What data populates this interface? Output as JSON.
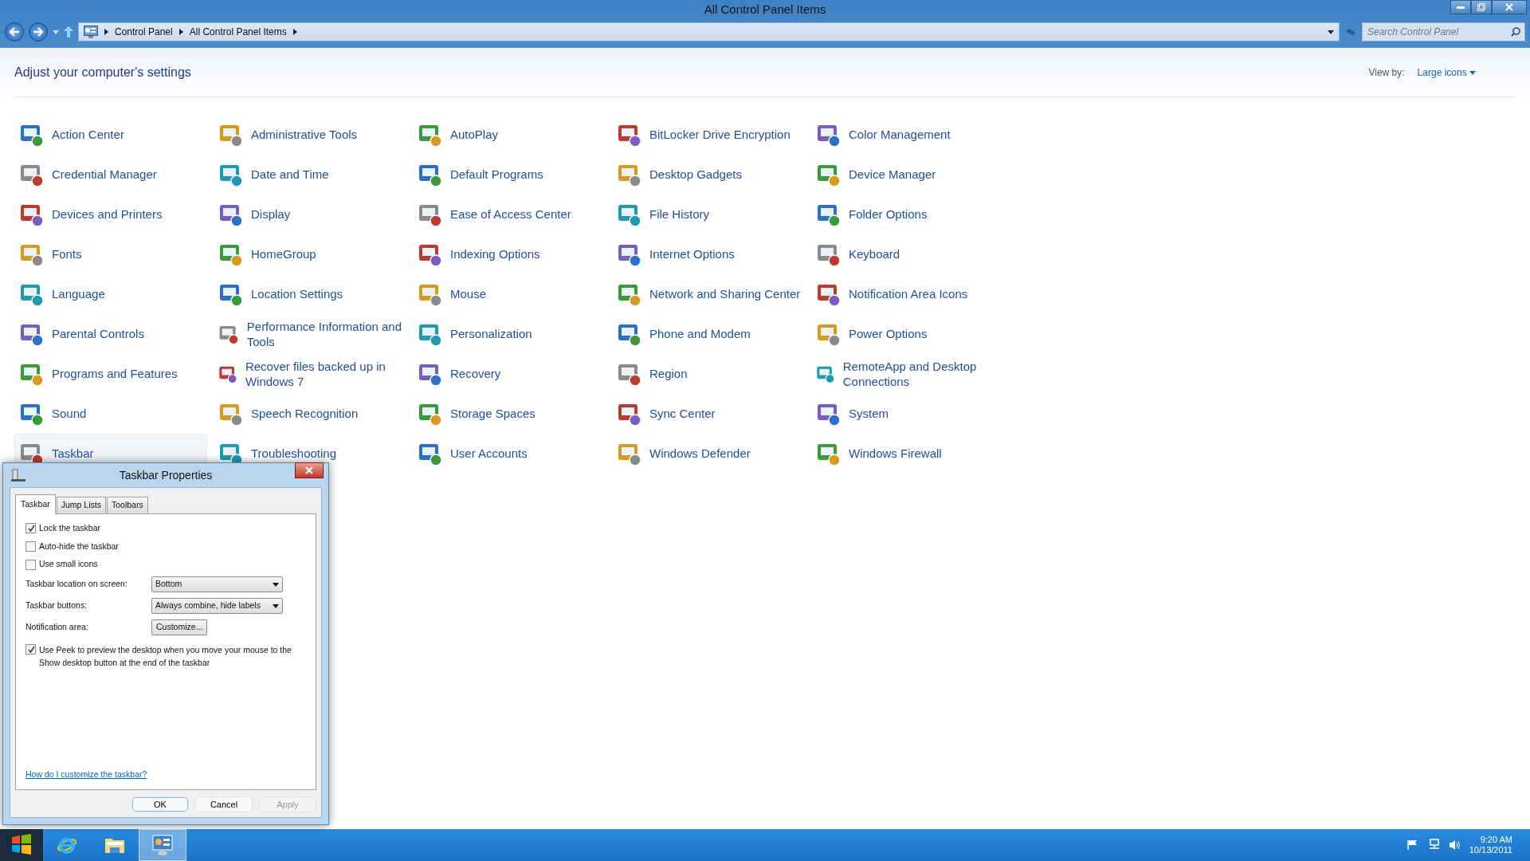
{
  "window": {
    "title": "All Control Panel Items"
  },
  "address_bar": {
    "crumbs": [
      "Control Panel",
      "All Control Panel Items"
    ]
  },
  "search": {
    "placeholder": "Search Control Panel"
  },
  "heading": "Adjust your computer's settings",
  "view_by": {
    "label": "View by:",
    "value": "Large icons"
  },
  "items": [
    {
      "label": "Action Center",
      "selected": false
    },
    {
      "label": "Administrative Tools",
      "selected": false
    },
    {
      "label": "AutoPlay",
      "selected": false
    },
    {
      "label": "BitLocker Drive Encryption",
      "selected": false
    },
    {
      "label": "Color Management",
      "selected": false
    },
    {
      "label": "Credential Manager",
      "selected": false
    },
    {
      "label": "Date and Time",
      "selected": false
    },
    {
      "label": "Default Programs",
      "selected": false
    },
    {
      "label": "Desktop Gadgets",
      "selected": false
    },
    {
      "label": "Device Manager",
      "selected": false
    },
    {
      "label": "Devices and Printers",
      "selected": false
    },
    {
      "label": "Display",
      "selected": false
    },
    {
      "label": "Ease of Access Center",
      "selected": false
    },
    {
      "label": "File History",
      "selected": false
    },
    {
      "label": "Folder Options",
      "selected": false
    },
    {
      "label": "Fonts",
      "selected": false
    },
    {
      "label": "HomeGroup",
      "selected": false
    },
    {
      "label": "Indexing Options",
      "selected": false
    },
    {
      "label": "Internet Options",
      "selected": false
    },
    {
      "label": "Keyboard",
      "selected": false
    },
    {
      "label": "Language",
      "selected": false
    },
    {
      "label": "Location Settings",
      "selected": false
    },
    {
      "label": "Mouse",
      "selected": false
    },
    {
      "label": "Network and Sharing Center",
      "selected": false
    },
    {
      "label": "Notification Area Icons",
      "selected": false
    },
    {
      "label": "Parental Controls",
      "selected": false
    },
    {
      "label": "Performance Information and Tools",
      "selected": false
    },
    {
      "label": "Personalization",
      "selected": false
    },
    {
      "label": "Phone and Modem",
      "selected": false
    },
    {
      "label": "Power Options",
      "selected": false
    },
    {
      "label": "Programs and Features",
      "selected": false
    },
    {
      "label": "Recover files backed up in Windows 7",
      "selected": false
    },
    {
      "label": "Recovery",
      "selected": false
    },
    {
      "label": "Region",
      "selected": false
    },
    {
      "label": "RemoteApp and Desktop Connections",
      "selected": false
    },
    {
      "label": "Sound",
      "selected": false
    },
    {
      "label": "Speech Recognition",
      "selected": false
    },
    {
      "label": "Storage Spaces",
      "selected": false
    },
    {
      "label": "Sync Center",
      "selected": false
    },
    {
      "label": "System",
      "selected": false
    },
    {
      "label": "Taskbar",
      "selected": true
    },
    {
      "label": "Troubleshooting",
      "selected": false
    },
    {
      "label": "User Accounts",
      "selected": false
    },
    {
      "label": "Windows Defender",
      "selected": false
    },
    {
      "label": "Windows Firewall",
      "selected": false
    }
  ],
  "dialog": {
    "title": "Taskbar Properties",
    "tabs": [
      {
        "label": "Taskbar",
        "selected": true
      },
      {
        "label": "Jump Lists",
        "selected": false
      },
      {
        "label": "Toolbars",
        "selected": false
      }
    ],
    "options": [
      {
        "label": "Lock the taskbar",
        "checked": true
      },
      {
        "label": "Auto-hide the taskbar",
        "checked": false
      },
      {
        "label": "Use small icons",
        "checked": false
      }
    ],
    "settings": [
      {
        "label": "Taskbar location on screen:",
        "kind": "dropdown",
        "value": "Bottom"
      },
      {
        "label": "Taskbar buttons:",
        "kind": "dropdown",
        "value": "Always combine, hide labels"
      },
      {
        "label": "Notification area:",
        "kind": "button",
        "value": "Customize..."
      }
    ],
    "peek": {
      "label": "Use Peek to preview the desktop when you move your mouse to the Show desktop button at the end of the taskbar",
      "checked": true
    },
    "help_link": "How do I customize the taskbar?",
    "buttons": [
      {
        "label": "OK",
        "default": true,
        "disabled": false
      },
      {
        "label": "Cancel",
        "default": false,
        "disabled": false
      },
      {
        "label": "Apply",
        "default": false,
        "disabled": true
      }
    ]
  },
  "taskbar": {
    "apps": [
      {
        "kind": "start",
        "selected": false
      },
      {
        "kind": "browser",
        "selected": false
      },
      {
        "kind": "folder",
        "selected": false
      },
      {
        "kind": "control-panel",
        "selected": true
      }
    ],
    "tray": [
      {
        "kind": "flag"
      },
      {
        "kind": "network"
      },
      {
        "kind": "speaker"
      }
    ],
    "time": "9:20 AM",
    "date": "10/13/2011"
  }
}
